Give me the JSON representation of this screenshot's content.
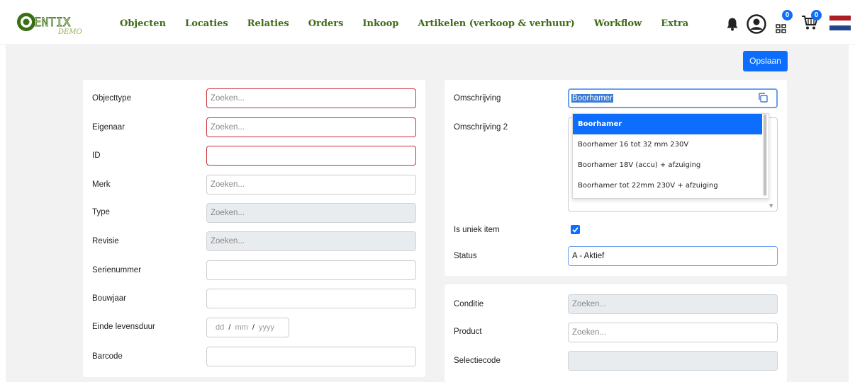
{
  "brand": {
    "logo_text": "CENTIX",
    "logo_sub": "DEMO"
  },
  "nav": [
    "Objecten",
    "Locaties",
    "Relaties",
    "Orders",
    "Inkoop",
    "Artikelen (verkoop & verhuur)",
    "Workflow",
    "Extra"
  ],
  "header_icons": {
    "bell": "bell-icon",
    "user": "user-circle-icon",
    "scan_badge": "0",
    "cart_badge": "0",
    "flag": "netherlands-flag-icon"
  },
  "toolbar": {
    "save_label": "Opslaan"
  },
  "left_form": {
    "objecttype": {
      "label": "Objecttype",
      "placeholder": "Zoeken..."
    },
    "eigenaar": {
      "label": "Eigenaar",
      "placeholder": "Zoeken..."
    },
    "id": {
      "label": "ID",
      "value": ""
    },
    "merk": {
      "label": "Merk",
      "placeholder": "Zoeken..."
    },
    "type": {
      "label": "Type",
      "placeholder": "Zoeken..."
    },
    "revisie": {
      "label": "Revisie",
      "placeholder": "Zoeken..."
    },
    "serienummer": {
      "label": "Serienummer",
      "value": ""
    },
    "bouwjaar": {
      "label": "Bouwjaar",
      "value": ""
    },
    "einde_levensduur": {
      "label": "Einde levensduur",
      "dd": "dd",
      "mm": "mm",
      "yyyy": "yyyy",
      "sep": "/"
    },
    "barcode": {
      "label": "Barcode",
      "value": ""
    }
  },
  "right_form": {
    "omschrijving": {
      "label": "Omschrijving",
      "value": "Boorhamer",
      "icon": "copy-icon"
    },
    "omschrijving2": {
      "label": "Omschrijving 2"
    },
    "autocomplete": [
      "Boorhamer",
      "Boorhamer 16 tot 32 mm 230V",
      "Boorhamer 18V (accu) + afzuiging",
      "Boorhamer tot 22mm 230V + afzuiging"
    ],
    "uniek": {
      "label": "Is uniek item",
      "checked": true
    },
    "status": {
      "label": "Status",
      "value": "A - Aktief"
    }
  },
  "right_form2": {
    "conditie": {
      "label": "Conditie",
      "placeholder": "Zoeken..."
    },
    "product": {
      "label": "Product",
      "placeholder": "Zoeken..."
    },
    "selectiecode": {
      "label": "Selectiecode",
      "value": ""
    }
  },
  "colors": {
    "accent": "#0d6efd",
    "nav": "#3d6a16",
    "error_border": "#c8303a"
  }
}
